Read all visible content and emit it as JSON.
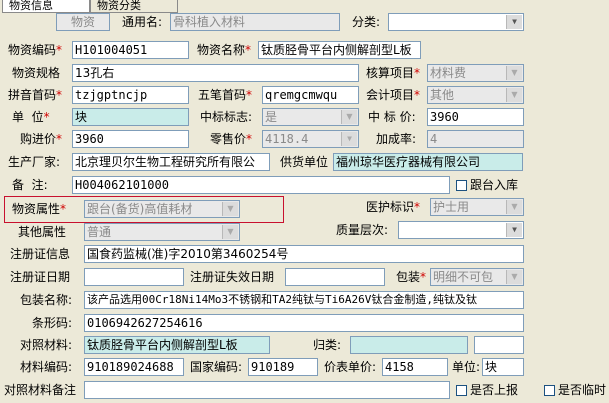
{
  "tabs": [
    "物资信息",
    "物资分类"
  ],
  "search": {
    "placeholder_box": "物资",
    "generic_name_label": "通用名:",
    "generic_name_value": "骨科植入材料",
    "category_label": "分类:",
    "category_value": ""
  },
  "fields": {
    "code_label": "物资编码",
    "code_value": "H101004051",
    "name_label": "物资名称",
    "name_value": "钛质胫骨平台内侧解剖型L板",
    "spec_label": "物资规格",
    "spec_value": "13孔右",
    "account_item_label": "核算项目",
    "account_item_value": "材料费",
    "pinyin_label": "拼音首码",
    "pinyin_value": "tzjgptncjp",
    "wubi_label": "五笔首码",
    "wubi_value": "qremgcmwqu",
    "acct_item_label": "会计项目",
    "acct_item_value": "其他",
    "unit_label": "单  位",
    "unit_value": "块",
    "bid_flag_label": "中标标志:",
    "bid_flag_value": "是",
    "bid_price_label": "中 标 价:",
    "bid_price_value": "3960",
    "purchase_price_label": "购进价",
    "purchase_price_value": "3960",
    "retail_price_label": "零售价",
    "retail_price_value": "4118.4",
    "markup_label": "加成率:",
    "markup_value": "4",
    "manufacturer_label": "生产厂家:",
    "manufacturer_value": "北京理贝尔生物工程研究所有限公",
    "supplier_label": "供货单位",
    "supplier_value": "福州琼华医疗器械有限公司",
    "note_label": "备  注:",
    "note_value": "H004062101000",
    "stock_in_label": "跟台入库",
    "attr_label": "物资属性",
    "attr_value": "跟台(备货)高值耗材",
    "insurance_label": "医护标识",
    "insurance_value": "护士用",
    "other_attr_label": "其他属性",
    "other_attr_value": "普通",
    "quality_label": "质量层次:",
    "quality_value": "",
    "reg_info_label": "注册证信息",
    "reg_info_value": "国食药监械(准)字2010第3460254号",
    "reg_date_label": "注册证日期",
    "reg_date_value": "",
    "reg_expire_label": "注册证失效日期",
    "reg_expire_value": "",
    "package_label": "包装",
    "package_value": "明细不可包",
    "package_name_label": "包装名称:",
    "package_name_value": "该产品选用00Cr18Ni14Mo3不锈钢和TA2纯钛与Ti6A26V钛合金制造,纯钛及钛",
    "barcode_label": "条形码:",
    "barcode_value": "0106942627254616",
    "compare_label": "对照材料:",
    "compare_value": "钛质胫骨平台内侧解剖型L板",
    "belong_label": "归类:",
    "belong_value": "",
    "material_code_label": "材料编码:",
    "material_code_value": "910189024688",
    "national_code_label": "国家编码:",
    "national_code_value": "910189",
    "price_label": "价表单价:",
    "price_value": "4158",
    "unit2_label": "单位:",
    "unit2_value": "块",
    "compare_note_label": "对照材料备注",
    "compare_note_value": "",
    "is_reported_label": "是否上报",
    "is_temp_label": "是否临时"
  }
}
